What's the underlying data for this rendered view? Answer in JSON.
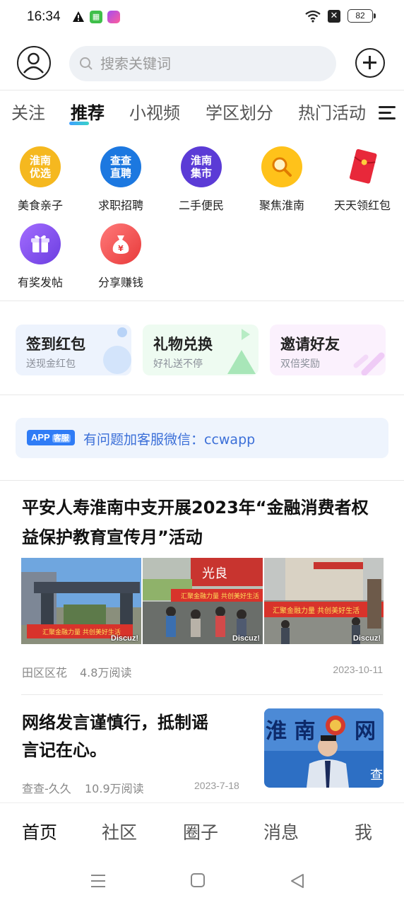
{
  "status_bar": {
    "time": "16:34",
    "battery": "82",
    "icons": [
      "warning-icon",
      "app-notification-icon",
      "app-notification-icon",
      "wifi-icon",
      "close-box-icon",
      "battery-icon"
    ]
  },
  "header": {
    "search_placeholder": "搜索关键词"
  },
  "tabs": [
    {
      "label": "关注"
    },
    {
      "label": "推荐"
    },
    {
      "label": "小视频"
    },
    {
      "label": "学区划分"
    },
    {
      "label": "热门活动"
    }
  ],
  "active_tab": "推荐",
  "quick_icons": [
    {
      "label": "美食亲子",
      "icon_text": "淮南\n优选",
      "color": "#f5b81f"
    },
    {
      "label": "求职招聘",
      "icon_text": "查查\n直聘",
      "color": "#1c78e0"
    },
    {
      "label": "二手便民",
      "icon_text": "淮南\n集市",
      "color": "#5b3bd6"
    },
    {
      "label": "聚焦淮南",
      "icon_text": "",
      "color": "#ffc21a"
    },
    {
      "label": "天天领红包",
      "icon_text": "",
      "color": "#e8283a"
    },
    {
      "label": "有奖发帖",
      "icon_text": "",
      "color": "#8d55f0"
    },
    {
      "label": "分享赚钱",
      "icon_text": "¥",
      "color": "#f25252"
    }
  ],
  "cards": [
    {
      "title": "签到红包",
      "subtitle": "送现金红包"
    },
    {
      "title": "礼物兑换",
      "subtitle": "好礼送不停"
    },
    {
      "title": "邀请好友",
      "subtitle": "双倍奖励"
    }
  ],
  "service_banner": {
    "badge": "APP",
    "badge_sub": "客服",
    "text": "有问题加客服微信：ccwapp"
  },
  "articles": [
    {
      "title_line1": "平安人寿淮南中支开展2023年“金融消费者权",
      "title_line2": "益保护教育宣传月”活动",
      "thumb_watermark": "Discuz!",
      "author": "田区区花",
      "reads": "4.8万阅读",
      "date": "2023-10-11"
    },
    {
      "title_line1": "网络发言谨慎行，抵制谣",
      "title_line2": "言记在心。",
      "author": "查查-久久",
      "reads": "10.9万阅读",
      "date": "2023-7-18"
    }
  ],
  "bottom_nav": [
    {
      "label": "首页"
    },
    {
      "label": "社区"
    },
    {
      "label": "圈子"
    },
    {
      "label": "消息"
    },
    {
      "label": "我"
    }
  ]
}
